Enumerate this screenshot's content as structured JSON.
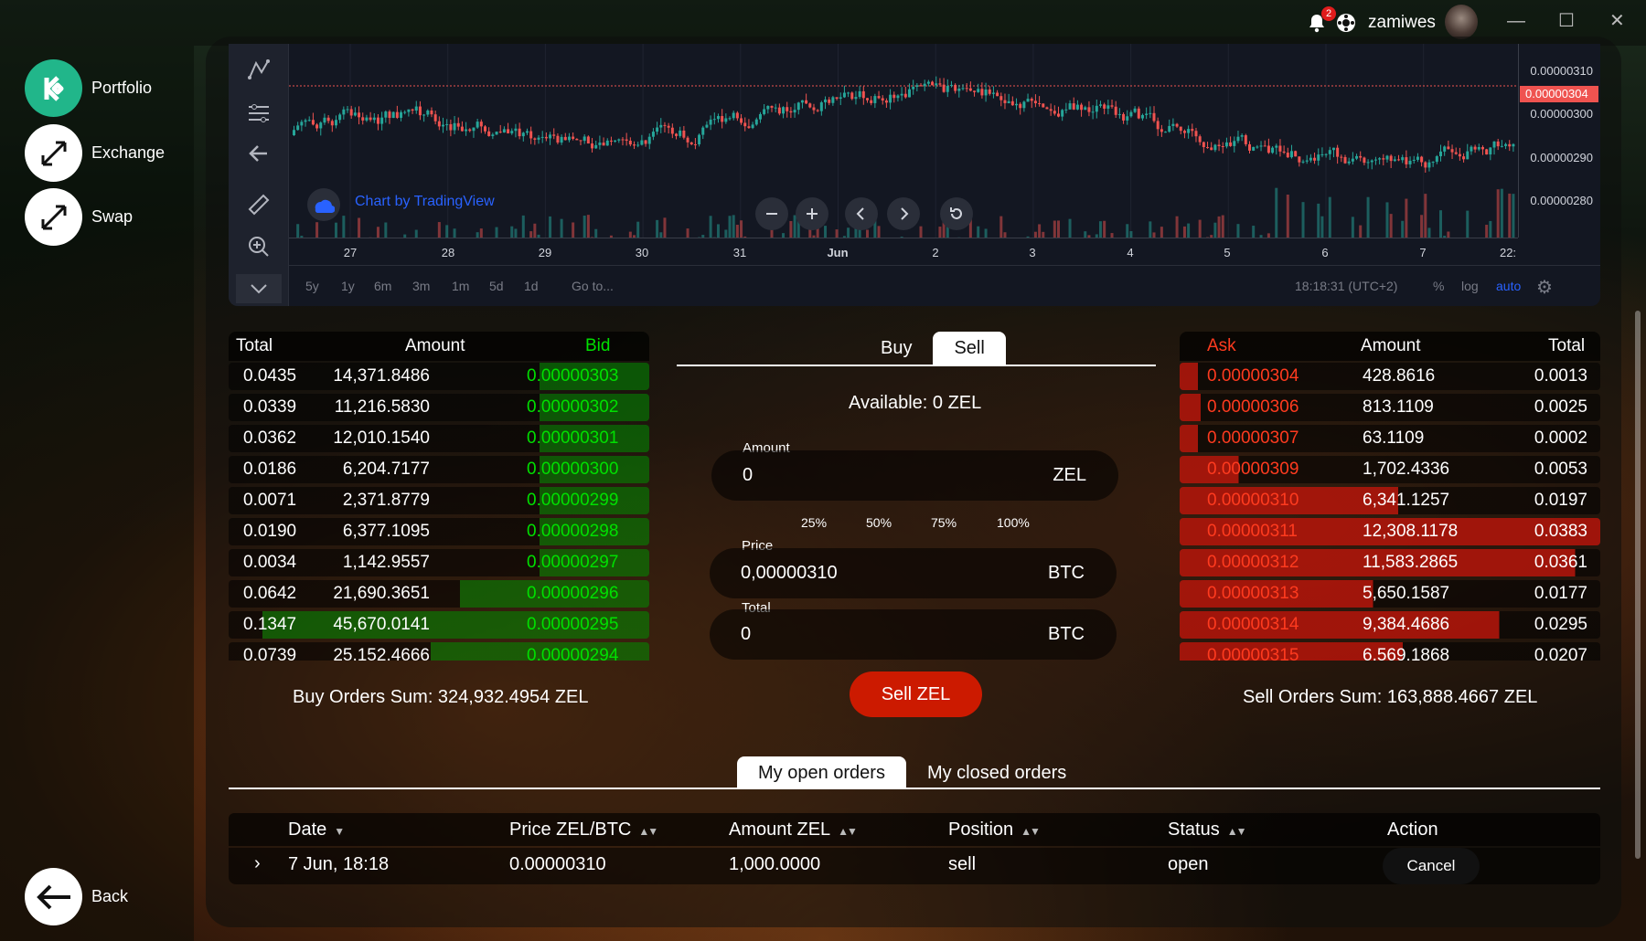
{
  "header": {
    "notification_count": "2",
    "username": "zamiwes"
  },
  "sidebar": {
    "items": [
      {
        "label": "Portfolio"
      },
      {
        "label": "Exchange"
      },
      {
        "label": "Swap"
      }
    ],
    "back_label": "Back"
  },
  "chart": {
    "watermark": "Chart by TradingView",
    "y_ticks": [
      "0.00000310",
      "0.00000300",
      "0.00000290",
      "0.00000280"
    ],
    "current_price": "0.00000304",
    "x_ticks": [
      "27",
      "28",
      "29",
      "30",
      "31",
      "Jun",
      "2",
      "3",
      "4",
      "5",
      "6",
      "7",
      "22:"
    ],
    "ranges": [
      "5y",
      "1y",
      "6m",
      "3m",
      "1m",
      "5d",
      "1d"
    ],
    "goto": "Go to...",
    "time": "18:18:31 (UTC+2)",
    "pct": "%",
    "log": "log",
    "auto": "auto"
  },
  "chart_data": {
    "type": "candlestick",
    "x_tick_labels": [
      "27",
      "28",
      "29",
      "30",
      "31",
      "Jun",
      "2",
      "3",
      "4",
      "5",
      "6",
      "7",
      "22:"
    ],
    "y_tick_labels": [
      "0.00000310",
      "0.00000300",
      "0.00000290",
      "0.00000280"
    ],
    "last_price": 3.04e-06,
    "colors": {
      "up": "#26a69a",
      "down": "#ef5350"
    }
  },
  "buy_book": {
    "headers": {
      "total": "Total",
      "amount": "Amount",
      "bid": "Bid"
    },
    "rows": [
      {
        "total": "0.0435",
        "amount": "14,371.8486",
        "bid": "0.00000303",
        "depth": 0.25
      },
      {
        "total": "0.0339",
        "amount": "11,216.5830",
        "bid": "0.00000302",
        "depth": 0.2
      },
      {
        "total": "0.0362",
        "amount": "12,010.1540",
        "bid": "0.00000301",
        "depth": 0.22
      },
      {
        "total": "0.0186",
        "amount": "6,204.7177",
        "bid": "0.00000300",
        "depth": 0.13
      },
      {
        "total": "0.0071",
        "amount": "2,371.8779",
        "bid": "0.00000299",
        "depth": 0.05
      },
      {
        "total": "0.0190",
        "amount": "6,377.1095",
        "bid": "0.00000298",
        "depth": 0.14
      },
      {
        "total": "0.0034",
        "amount": "1,142.9557",
        "bid": "0.00000297",
        "depth": 0.03
      },
      {
        "total": "0.0642",
        "amount": "21,690.3651",
        "bid": "0.00000296",
        "depth": 0.45
      },
      {
        "total": "0.1347",
        "amount": "45,670.0141",
        "bid": "0.00000295",
        "depth": 0.92
      },
      {
        "total": "0.0739",
        "amount": "25,152.4666",
        "bid": "0.00000294",
        "depth": 0.52
      }
    ],
    "sum": "Buy Orders Sum: 324,932.4954 ZEL"
  },
  "sell_book": {
    "headers": {
      "ask": "Ask",
      "amount": "Amount",
      "total": "Total"
    },
    "rows": [
      {
        "ask": "0.00000304",
        "amount": "428.8616",
        "total": "0.0013",
        "depth": 0.03
      },
      {
        "ask": "0.00000306",
        "amount": "813.1109",
        "total": "0.0025",
        "depth": 0.05
      },
      {
        "ask": "0.00000307",
        "amount": "63.1109",
        "total": "0.0002",
        "depth": 0.01
      },
      {
        "ask": "0.00000309",
        "amount": "1,702.4336",
        "total": "0.0053",
        "depth": 0.14
      },
      {
        "ask": "0.00000310",
        "amount": "6,341.1257",
        "total": "0.0197",
        "depth": 0.52
      },
      {
        "ask": "0.00000311",
        "amount": "12,308.1178",
        "total": "0.0383",
        "depth": 1.0
      },
      {
        "ask": "0.00000312",
        "amount": "11,583.2865",
        "total": "0.0361",
        "depth": 0.94
      },
      {
        "ask": "0.00000313",
        "amount": "5,650.1587",
        "total": "0.0177",
        "depth": 0.46
      },
      {
        "ask": "0.00000314",
        "amount": "9,384.4686",
        "total": "0.0295",
        "depth": 0.76
      },
      {
        "ask": "0.00000315",
        "amount": "6,569.1868",
        "total": "0.0207",
        "depth": 0.53
      }
    ],
    "sum": "Sell Orders Sum: 163,888.4667 ZEL"
  },
  "trade": {
    "tab_buy": "Buy",
    "tab_sell": "Sell",
    "available": "Available: 0 ZEL",
    "amount_label": "Amount",
    "amount_value": "0",
    "amount_unit": "ZEL",
    "percentages": [
      "25%",
      "50%",
      "75%",
      "100%"
    ],
    "price_label": "Price",
    "price_value": "0,00000310",
    "price_unit": "BTC",
    "total_label": "Total",
    "total_value": "0",
    "total_unit": "BTC",
    "submit": "Sell ZEL"
  },
  "orders": {
    "tab_open": "My open orders",
    "tab_closed": "My closed orders",
    "headers": {
      "date": "Date",
      "price": "Price ZEL/BTC",
      "amount": "Amount ZEL",
      "position": "Position",
      "status": "Status",
      "action": "Action"
    },
    "row": {
      "date": "7 Jun, 18:18",
      "price": "0.00000310",
      "amount": "1,000.0000",
      "position": "sell",
      "status": "open",
      "action": "Cancel"
    }
  },
  "colors": {
    "bid": "#00e000",
    "ask": "#ff3b1f",
    "sell_button": "#cc1a00",
    "accent": "#2962ff"
  }
}
